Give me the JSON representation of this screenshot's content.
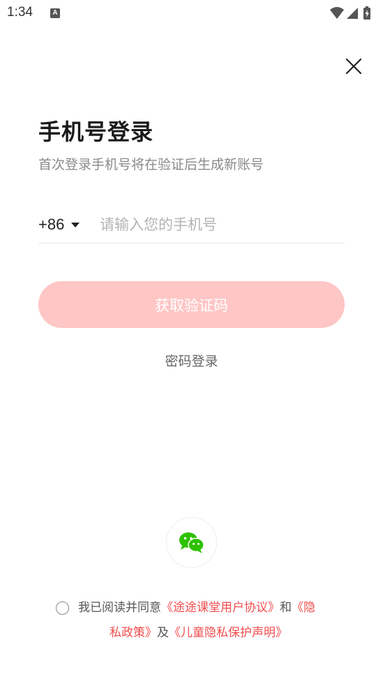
{
  "status_bar": {
    "time": "1:34",
    "notification_icon": "A"
  },
  "login": {
    "title": "手机号登录",
    "subtitle": "首次登录手机号将在验证后生成新账号",
    "country_code": "+86",
    "phone_placeholder": "请输入您的手机号",
    "phone_value": "",
    "get_code_label": "获取验证码",
    "password_login_label": "密码登录"
  },
  "agreement": {
    "prefix": "我已阅读并同意",
    "user_agreement_part1": "《途途课堂用户协议》",
    "and": "和",
    "privacy_part1": "《隐",
    "privacy_part2": "私政策》",
    "and2": "及",
    "children_privacy": "《儿童隐私保护声明》"
  },
  "colors": {
    "accent": "#f04d4d",
    "button_disabled": "#fec6c5",
    "wechat_green": "#2dc100"
  }
}
